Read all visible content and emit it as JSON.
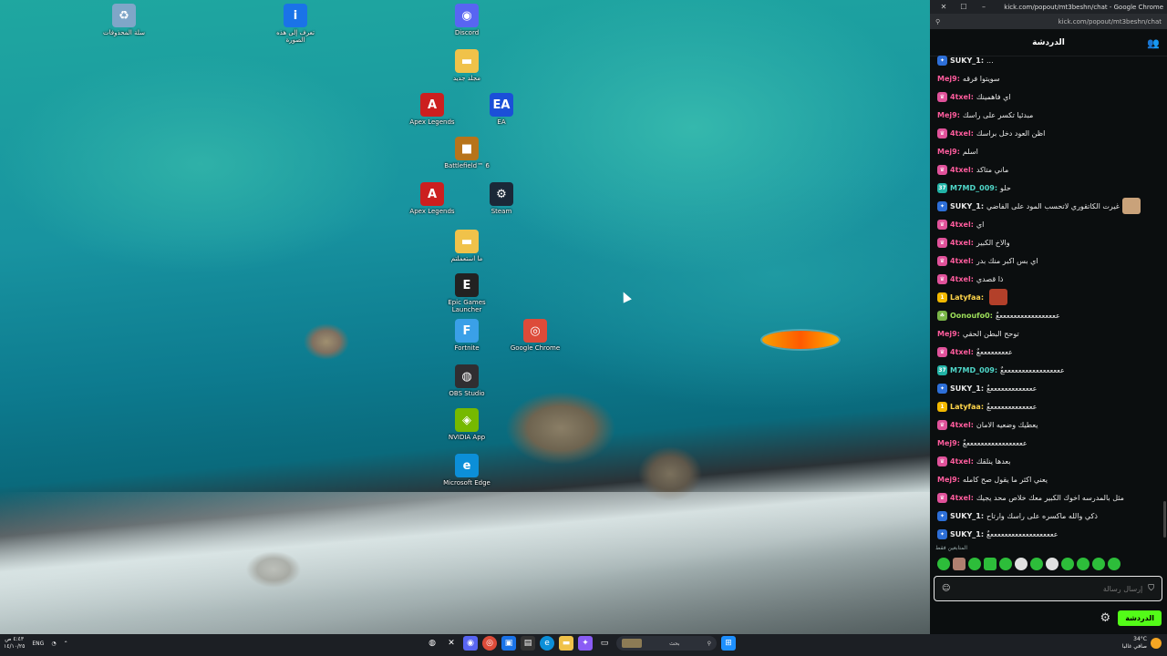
{
  "desktop": {
    "icons": [
      {
        "label": "سلة المحذوفات",
        "icon": "recycle-bin-icon",
        "color": "#7fa6c8",
        "glyph": "♻"
      },
      {
        "label": "تعرف إلى هذه الصورة",
        "icon": "spotlight-icon",
        "color": "#1a73e8",
        "glyph": "i"
      },
      {
        "label": "Discord",
        "icon": "discord-icon",
        "color": "#5865f2",
        "glyph": "◉"
      },
      {
        "label": "مجلد جديد",
        "icon": "folder-icon",
        "color": "#f0c24a",
        "glyph": "▬"
      },
      {
        "label": "Apex Legends",
        "icon": "apex-icon",
        "color": "#cc1f1f",
        "glyph": "A"
      },
      {
        "label": "EA",
        "icon": "ea-icon",
        "color": "#1b4fd8",
        "glyph": "EA"
      },
      {
        "label": "Battlefield™ 6",
        "icon": "battlefield-icon",
        "color": "#b7741a",
        "glyph": "■"
      },
      {
        "label": "Apex Legends",
        "icon": "apex-icon",
        "color": "#cc1f1f",
        "glyph": "A"
      },
      {
        "label": "Steam",
        "icon": "steam-icon",
        "color": "#1b2838",
        "glyph": "⚙"
      },
      {
        "label": "ما استعملتم",
        "icon": "folder-icon",
        "color": "#f0c24a",
        "glyph": "▬"
      },
      {
        "label": "Epic Games Launcher",
        "icon": "epic-icon",
        "color": "#222",
        "glyph": "E"
      },
      {
        "label": "Fortnite",
        "icon": "fortnite-icon",
        "color": "#3aa0e8",
        "glyph": "F"
      },
      {
        "label": "Google Chrome",
        "icon": "chrome-icon",
        "color": "#dd4b39",
        "glyph": "◎"
      },
      {
        "label": "OBS Studio",
        "icon": "obs-icon",
        "color": "#302e31",
        "glyph": "◍"
      },
      {
        "label": "NVIDIA App",
        "icon": "nvidia-icon",
        "color": "#76b900",
        "glyph": "◈"
      },
      {
        "label": "Microsoft Edge",
        "icon": "edge-icon",
        "color": "#0c8fd8",
        "glyph": "e"
      }
    ]
  },
  "browser": {
    "window_title": "kick.com/popout/mt3beshn/chat - Google Chrome",
    "url": "kick.com/popout/mt3beshn/chat",
    "close": "✕",
    "maximize": "☐",
    "minimize": "–"
  },
  "chat": {
    "header_title": "الدردشة",
    "colors": {
      "brand_green": "#53fc18"
    },
    "messages": [
      {
        "user": "SUKY_1:",
        "text": "...",
        "badge": "#2d6fd8",
        "user_color": "#e8e8e8",
        "badge_glyph": "✦"
      },
      {
        "user": "Mej9:",
        "text": "سويتوا فرقه",
        "badge": "",
        "user_color": "#ff5c9d",
        "badge_glyph": ""
      },
      {
        "user": "4txel:",
        "text": "اي فاهمينك",
        "badge": "#e0529a",
        "user_color": "#ff5c9d",
        "badge_glyph": "♛"
      },
      {
        "user": "Mej9:",
        "text": "مبدئيا تكسر على راسك",
        "badge": "",
        "user_color": "#ff5c9d",
        "badge_glyph": ""
      },
      {
        "user": "4txel:",
        "text": "اظن العود دخل براسك",
        "badge": "#e0529a",
        "user_color": "#ff5c9d",
        "badge_glyph": "♛"
      },
      {
        "user": "Mej9:",
        "text": "اسلم",
        "badge": "",
        "user_color": "#ff5c9d",
        "badge_glyph": ""
      },
      {
        "user": "4txel:",
        "text": "ماني متاكد",
        "badge": "#e0529a",
        "user_color": "#ff5c9d",
        "badge_glyph": "♛"
      },
      {
        "user": "M7MD_009:",
        "text": "حلو",
        "badge": "#22b3a6",
        "user_color": "#4fd6c8",
        "badge_glyph": "37"
      },
      {
        "user": "SUKY_1:",
        "text": "غيرت الكاتقوري لاتحسب المود على الفاضي",
        "badge": "#2d6fd8",
        "user_color": "#e8e8e8",
        "badge_glyph": "✦",
        "emote": "#c9a27a"
      },
      {
        "user": "4txel:",
        "text": "اي",
        "badge": "#e0529a",
        "user_color": "#ff5c9d",
        "badge_glyph": "♛"
      },
      {
        "user": "4txel:",
        "text": "والاخ الكبير",
        "badge": "#e0529a",
        "user_color": "#ff5c9d",
        "badge_glyph": "♛"
      },
      {
        "user": "4txel:",
        "text": "اي بس اكبر منك بدر",
        "badge": "#e0529a",
        "user_color": "#ff5c9d",
        "badge_glyph": "♛"
      },
      {
        "user": "4txel:",
        "text": "ذا قصدي",
        "badge": "#e0529a",
        "user_color": "#ff5c9d",
        "badge_glyph": "♛"
      },
      {
        "user": "Latyfaa:",
        "text": "",
        "badge": "#f2b800",
        "user_color": "#ffd54a",
        "badge_glyph": "1",
        "emote": "#b3402a"
      },
      {
        "user": "Oonoufo0:",
        "text": "ٌعععععععععععععععععع",
        "badge": "#7ab648",
        "user_color": "#9ee05a",
        "badge_glyph": "☘"
      },
      {
        "user": "Mej9:",
        "text": "توحح البطن الحقي",
        "badge": "",
        "user_color": "#ff5c9d",
        "badge_glyph": ""
      },
      {
        "user": "4txel:",
        "text": "ٌعععععععععع",
        "badge": "#e0529a",
        "user_color": "#ff5c9d",
        "badge_glyph": "♛"
      },
      {
        "user": "M7MD_009:",
        "text": "ٌعععععععععععععععععع",
        "badge": "#22b3a6",
        "user_color": "#4fd6c8",
        "badge_glyph": "37"
      },
      {
        "user": "SUKY_1:",
        "text": "ٌعععععععععععععع",
        "badge": "#2d6fd8",
        "user_color": "#e8e8e8",
        "badge_glyph": "✦"
      },
      {
        "user": "Latyfaa:",
        "text": "ٌعععععععععععععع",
        "badge": "#f2b800",
        "user_color": "#ffd54a",
        "badge_glyph": "1"
      },
      {
        "user": "4txel:",
        "text": "يعطيك وضعيه الامان",
        "badge": "#e0529a",
        "user_color": "#ff5c9d",
        "badge_glyph": "♛"
      },
      {
        "user": "Mej9:",
        "text": "ٌعععععععععععععععععع",
        "badge": "",
        "user_color": "#ff5c9d",
        "badge_glyph": ""
      },
      {
        "user": "4txel:",
        "text": "بعدها ينلقك",
        "badge": "#e0529a",
        "user_color": "#ff5c9d",
        "badge_glyph": "♛"
      },
      {
        "user": "Mej9:",
        "text": "يعني اكثر ما يقول صح كامله",
        "badge": "",
        "user_color": "#ff5c9d",
        "badge_glyph": ""
      },
      {
        "user": "4txel:",
        "text": "مثل بالمدرسه اخوك الكبير معك خلاص محد يجيك",
        "badge": "#e0529a",
        "user_color": "#ff5c9d",
        "badge_glyph": "♛"
      },
      {
        "user": "SUKY_1:",
        "text": "ذكي والله ماكسره على راسك وارتاح",
        "badge": "#2d6fd8",
        "user_color": "#e8e8e8",
        "badge_glyph": "✦"
      },
      {
        "user": "SUKY_1:",
        "text": "ٌعععععععععععععععععععع",
        "badge": "#2d6fd8",
        "user_color": "#e8e8e8",
        "badge_glyph": "✦"
      }
    ],
    "emote_hint": "المتابعين فقط",
    "input_placeholder": "إرسال رسالة",
    "send_label": "الدردشة"
  },
  "taskbar": {
    "clock_time": "٤:٤٣ ص",
    "clock_date": "١٤/١٠/٢٥",
    "language": "ENG",
    "search_placeholder": "بحث",
    "weather_temp": "34°C",
    "weather_desc": "صافي غالبا"
  }
}
